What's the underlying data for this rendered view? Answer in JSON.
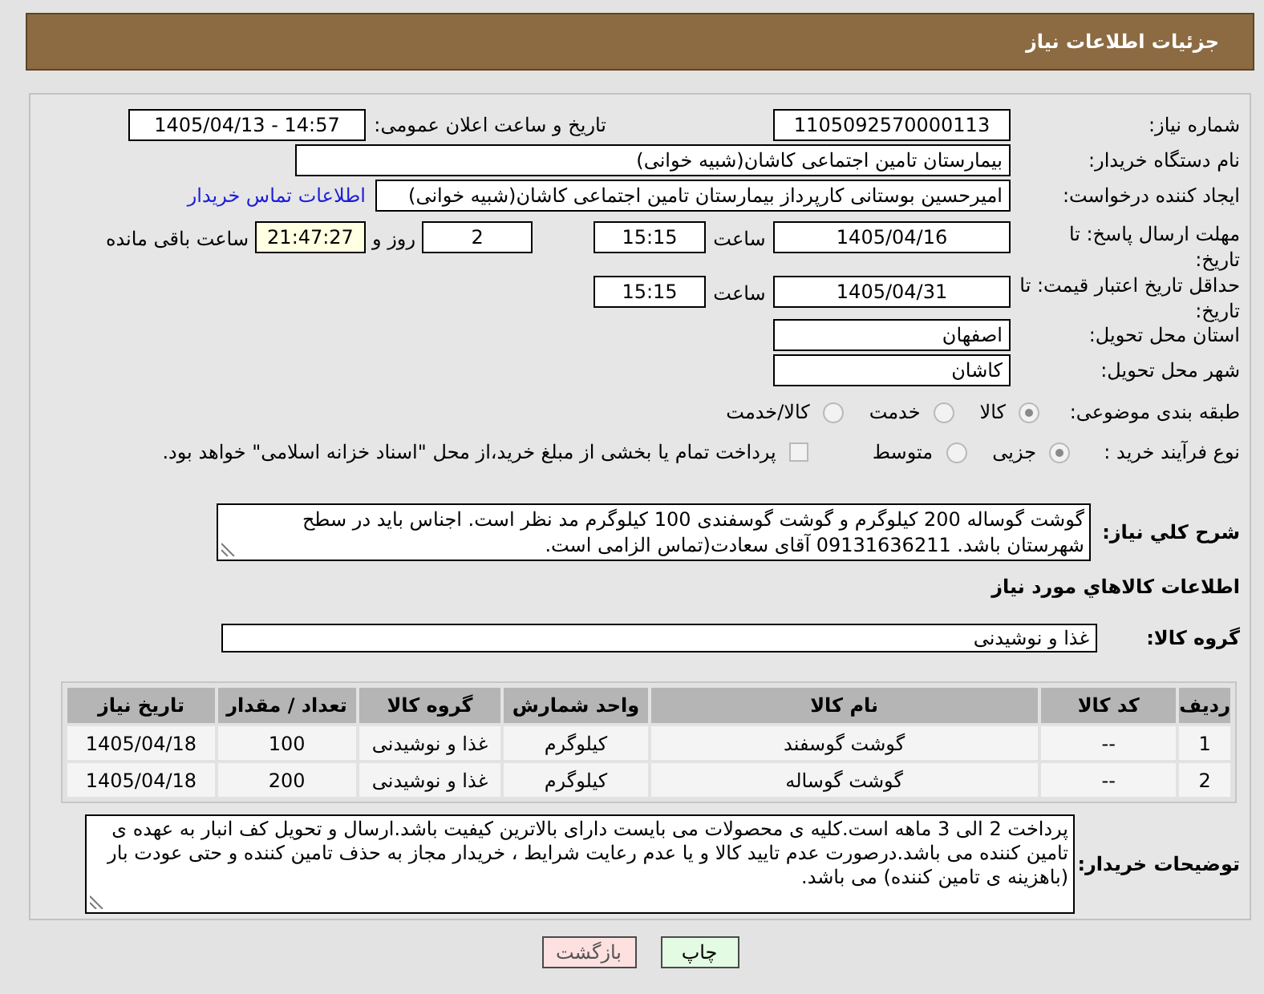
{
  "header": {
    "title": "جزئیات اطلاعات نیاز"
  },
  "need_number": {
    "label": "شماره نیاز:",
    "value": "1105092570000113"
  },
  "announce_datetime": {
    "label": "تاریخ و ساعت اعلان عمومی:",
    "value": "1405/04/13 - 14:57"
  },
  "buyer_org": {
    "label": "نام دستگاه خریدار:",
    "value": "بیمارستان تامین اجتماعی کاشان(شبیه خوانی)"
  },
  "requester": {
    "label": "ایجاد کننده درخواست:",
    "value": "امیرحسین بوستانی کارپرداز بیمارستان تامین اجتماعی کاشان(شبیه خوانی)",
    "link": "اطلاعات تماس خریدار"
  },
  "response_deadline": {
    "label": "مهلت ارسال پاسخ: تا تاریخ:",
    "date": "1405/04/16",
    "time_label": "ساعت",
    "time": "15:15",
    "days": "2",
    "days_label": "روز و",
    "remaining": "21:47:27",
    "remaining_label": "ساعت باقی مانده"
  },
  "price_validity": {
    "label": "حداقل تاریخ اعتبار قیمت: تا تاریخ:",
    "date": "1405/04/31",
    "time_label": "ساعت",
    "time": "15:15"
  },
  "province": {
    "label": "استان محل تحویل:",
    "value": "اصفهان"
  },
  "city": {
    "label": "شهر محل تحویل:",
    "value": "کاشان"
  },
  "category": {
    "label": "طبقه بندی موضوعی:",
    "options": [
      {
        "label": "کالا",
        "selected": true,
        "disabled": true
      },
      {
        "label": "خدمت",
        "selected": false,
        "disabled": true
      },
      {
        "label": "کالا/خدمت",
        "selected": false,
        "disabled": true
      }
    ]
  },
  "purchase_process": {
    "label": "نوع فرآیند خرید :",
    "options": [
      {
        "label": "جزیی",
        "selected": true,
        "disabled": true
      },
      {
        "label": "متوسط",
        "selected": false,
        "disabled": true
      }
    ],
    "treasury": {
      "label": "پرداخت تمام یا بخشی از مبلغ خرید،از محل \"اسناد خزانه اسلامی\" خواهد بود.",
      "checked": false,
      "disabled": true
    }
  },
  "description": {
    "label": "شرح کلي نیاز:",
    "value": "گوشت گوساله 200 کیلوگرم و گوشت گوسفندی 100 کیلوگرم مد نظر است. اجناس باید در سطح شهرستان باشد. 09131636211 آقای سعادت(تماس الزامی است."
  },
  "goods_section": {
    "title": "اطلاعات کالاهاي مورد نیاز"
  },
  "goods_group": {
    "label": "گروه کالا:",
    "value": "غذا و نوشیدنی"
  },
  "table": {
    "columns": [
      "ردیف",
      "کد کالا",
      "نام کالا",
      "واحد شمارش",
      "گروه کالا",
      "تعداد / مقدار",
      "تاریخ نیاز"
    ],
    "rows": [
      [
        "1",
        "--",
        "گوشت گوسفند",
        "کیلوگرم",
        "غذا و نوشیدنی",
        "100",
        "1405/04/18"
      ],
      [
        "2",
        "--",
        "گوشت گوساله",
        "کیلوگرم",
        "غذا و نوشیدنی",
        "200",
        "1405/04/18"
      ]
    ]
  },
  "buyer_notes": {
    "label": "توضیحات خریدار:",
    "value": "پرداخت 2 الی 3 ماهه است.کلیه ی محصولات می بایست دارای بالاترین کیفیت باشد.ارسال و تحویل کف انبار به عهده ی تامین کننده می باشد.درصورت عدم تایید کالا و یا عدم رعایت شرایط ، خریدار مجاز به حذف تامین کننده و حتی عودت بار (باهزینه ی تامین کننده) می باشد."
  },
  "buttons": [
    {
      "label": "چاپ",
      "kind": "print"
    },
    {
      "label": "بازگشت",
      "kind": "back"
    }
  ]
}
